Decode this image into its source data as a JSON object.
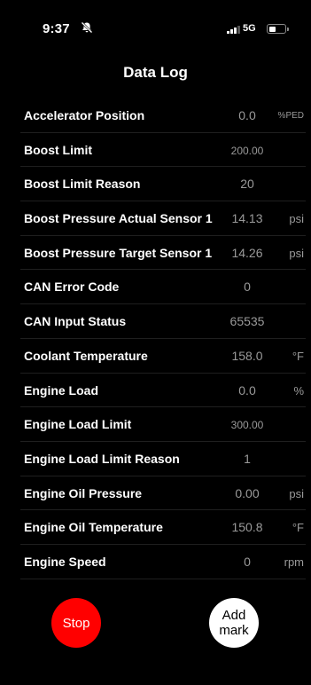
{
  "status_bar": {
    "time": "9:37",
    "network": "5G",
    "icons": [
      "silent-mode-icon",
      "signal-icon",
      "battery-icon"
    ]
  },
  "header": {
    "title": "Data Log"
  },
  "rows": [
    {
      "label": "Accelerator Position",
      "value": "0.0",
      "unit": "%PED"
    },
    {
      "label": "Boost Limit",
      "value": "200.00",
      "unit": ""
    },
    {
      "label": "Boost Limit Reason",
      "value": "20",
      "unit": ""
    },
    {
      "label": "Boost Pressure Actual Sensor 1",
      "value": "14.13",
      "unit": "psi"
    },
    {
      "label": "Boost Pressure Target Sensor 1",
      "value": "14.26",
      "unit": "psi"
    },
    {
      "label": "CAN Error Code",
      "value": "0",
      "unit": ""
    },
    {
      "label": "CAN Input Status",
      "value": "65535",
      "unit": ""
    },
    {
      "label": "Coolant Temperature",
      "value": "158.0",
      "unit": "°F"
    },
    {
      "label": "Engine Load",
      "value": "0.0",
      "unit": "%"
    },
    {
      "label": "Engine Load Limit",
      "value": "300.00",
      "unit": ""
    },
    {
      "label": "Engine Load Limit Reason",
      "value": "1",
      "unit": ""
    },
    {
      "label": "Engine Oil Pressure",
      "value": "0.00",
      "unit": "psi"
    },
    {
      "label": "Engine Oil Temperature",
      "value": "150.8",
      "unit": "°F"
    },
    {
      "label": "Engine Speed",
      "value": "0",
      "unit": "rpm"
    }
  ],
  "buttons": {
    "stop_label": "Stop",
    "add_mark_line1": "Add",
    "add_mark_line2": "mark"
  },
  "colors": {
    "background": "#000000",
    "stop": "#ff0000",
    "add_mark": "#ffffff",
    "value_text": "#9a9a9a"
  }
}
